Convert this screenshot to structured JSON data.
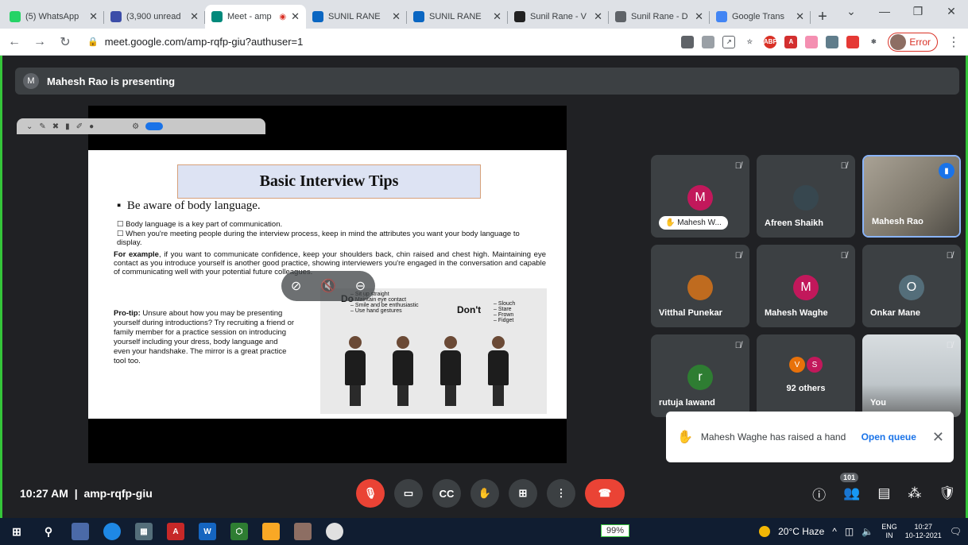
{
  "browser": {
    "tabs": [
      {
        "title": "(5) WhatsApp",
        "color": "#25d366",
        "icon": "whatsapp-icon",
        "active": false
      },
      {
        "title": "(3,900 unread",
        "color": "#3c4da8",
        "icon": "mail-icon",
        "active": false
      },
      {
        "title": "Meet - amp",
        "color": "#00897b",
        "icon": "meet-icon",
        "active": true
      },
      {
        "title": "SUNIL RANE",
        "color": "#0a66c2",
        "icon": "linkedin-icon",
        "active": false
      },
      {
        "title": "SUNIL RANE",
        "color": "#0a66c2",
        "icon": "linkedin-icon",
        "active": false
      },
      {
        "title": "Sunil Rane - V",
        "color": "#222222",
        "icon": "zoominfo-icon",
        "active": false
      },
      {
        "title": "Sunil Rane - D",
        "color": "#5f6368",
        "icon": "globe-icon",
        "active": false
      },
      {
        "title": "Google Trans",
        "color": "#4285f4",
        "icon": "translate-icon",
        "active": false
      }
    ],
    "url": "meet.google.com/amp-rqfp-giu?authuser=1",
    "error_label": "Error"
  },
  "presenting": {
    "initial": "M",
    "text": "Mahesh Rao is presenting"
  },
  "slide": {
    "title": "Basic Interview Tips",
    "heading": "Be aware of body language.",
    "bullets": [
      "Body language is a key part of communication.",
      "When you're meeting people during the interview process, keep in mind the attributes you want your body language to display."
    ],
    "example_label": "For example",
    "example_text": ", if you want to communicate confidence, keep your shoulders back, chin raised and chest high. Maintaining eye contact as you introduce yourself is another good practice, showing interviewers you're engaged in the conversation and capable of communicating well with your potential future colleagues.",
    "protip_label": "Pro-tip:",
    "protip_text": " Unsure about how you may be presenting yourself during introductions? Try recruiting a friend or family member for a practice session on introducing yourself including your dress, body language and even your handshake. The mirror is a great practice tool too.",
    "do_label": "Do",
    "do_list": [
      "Sit up straight",
      "Maintain eye contact",
      "Smile and be enthusiastic",
      "Use hand gestures"
    ],
    "dont_label": "Don't",
    "dont_list": [
      "Slouch",
      "Stare",
      "Frown",
      "Fidget"
    ]
  },
  "tiles": [
    {
      "name": "Mahesh W...",
      "initial": "M",
      "avatar_color": "#c2185b",
      "hand": true
    },
    {
      "name": "Afreen Shaikh",
      "initial": "",
      "avatar_color": "#37474f"
    },
    {
      "name": "Mahesh Rao",
      "initial": "",
      "avatar_color": "#8d6e63"
    },
    {
      "name": "Vitthal Punekar",
      "initial": "",
      "avatar_color": "#bf6b1f"
    },
    {
      "name": "Mahesh Waghe",
      "initial": "M",
      "avatar_color": "#c2185b"
    },
    {
      "name": "Onkar Mane",
      "initial": "O",
      "avatar_color": "#546e7a"
    },
    {
      "name": "rutuja lawand",
      "initial": "r",
      "avatar_color": "#2e7d32"
    },
    {
      "name": "92 others",
      "initial": "",
      "avatar_color": "#3c4043",
      "others": [
        "V",
        "S"
      ],
      "others_colors": [
        "#e8710a",
        "#c2185b"
      ]
    },
    {
      "name": "You",
      "initial": "",
      "avatar_color": "#9e9e9e"
    }
  ],
  "toast": {
    "text": "Mahesh Waghe has raised a hand",
    "action": "Open queue"
  },
  "meeting": {
    "time": "10:27 AM",
    "code": "amp-rqfp-giu",
    "participants": "101"
  },
  "taskbar": {
    "battery": "99%",
    "weather": "20°C  Haze",
    "lang1": "ENG",
    "lang2": "IN",
    "time": "10:27",
    "date": "10-12-2021"
  }
}
